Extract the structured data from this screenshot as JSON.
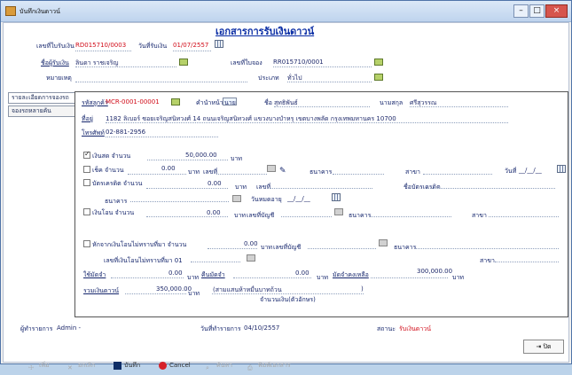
{
  "window": {
    "title": "บันทึกเงินดาวน์"
  },
  "doc": {
    "title": "เอกสารการรับเงินดาวน์"
  },
  "header": {
    "receipt_no_label": "เลขที่ใบรับเงิน",
    "receipt_no": "RD015710/0003",
    "receipt_date_label": "วันที่รับเงิน",
    "receipt_date": "01/07/2557",
    "receiver_label": "ชื่อผู้รับเงิน",
    "receiver": "ลินดา ราชเจริญ",
    "booking_label": "เลขที่ใบจอง",
    "booking_no": "RR015710/0001",
    "note_label": "หมายเหตุ",
    "type_label": "ประเภท",
    "type_value": "ทั่วไป"
  },
  "tabs": [
    {
      "label": "รายละเอียดการจองรถ"
    },
    {
      "label": "จองรถหลายคัน"
    }
  ],
  "customer": {
    "code_label": "รหัสลูกค้า",
    "code": "MCR-0001-00001",
    "title_label": "คำนำหน้า",
    "title": "นาย",
    "first_label": "ชื่อ",
    "first": "สุทธิพันธ์",
    "last_label": "นามสกุล",
    "last": "ศรีสุวรรณ",
    "address_label": "ที่อยู่",
    "address": "1182 ลิเบอร์ ซอยเจริญสนิทวงศ์ 14 ถนนเจริญสนิทวงศ์ แขวงบางบำหรุ เขตบางพลัด กรุงเทพมหานคร 10700",
    "phone_label": "โทรศัพท์",
    "phone": "02-881-2956"
  },
  "payment": {
    "cash_label": "เงินสด จำนวน",
    "cash_amount": "50,000.00",
    "cash_unit": "บาท",
    "cheque_label": "เช็ค จำนวน",
    "cheque_amount": "0.00",
    "cheque_unit": "บาท",
    "cheque_no_label": "เลขที่",
    "cheque_bank_label": "ธนาคาร",
    "cheque_branch_label": "สาขา",
    "cheque_date_label": "วันที่",
    "cheque_date": "__/__/__",
    "card_label": "บัตรเครดิต จำนวน",
    "card_amount": "0.00",
    "card_unit": "บาท",
    "card_no_label": "เลขที่",
    "card_bank_label": "ธนาคาร",
    "card_name_label": "ชื่อบัตรเครดิต",
    "card_expire_label": "วันหมดอายุ",
    "card_expire": "__/__/__",
    "transfer_label": "เงินโอน จำนวน",
    "transfer_amount": "0.00",
    "transfer_unit": "บาท",
    "account_label": "เลขที่บัญชี",
    "transfer_bank_label": "ธนาคาร",
    "transfer_branch_label": "สาขา",
    "deduct_label": "หักจากเงินโอนไม่ทราบที่มา จำนวน",
    "deduct_amount": "0.00",
    "deduct_unit": "บาท",
    "deduct_account_label": "เลขที่บัญชี",
    "deduct_bank_label": "ธนาคาร",
    "deduct_no_label": "เลขที่เงินโอนไม่ทราบที่มา 01",
    "deduct_branch_label": "สาขา",
    "discount_label": "ใช้มัดจำ",
    "discount_amount": "0.00",
    "discount_unit": "บาท",
    "deposit_label": "คืนมัดจำ",
    "deposit_amount": "0.00",
    "deposit_unit": "บาท",
    "remain_label": "มัดจำคงเหลือ",
    "remain_amount": "300,000.00",
    "remain_unit": "บาท",
    "total_label": "รวมเงินดาวน์",
    "total_amount": "350,000.00",
    "total_unit": "บาท",
    "total_words": "(สามแสนห้าหมื่นบาทถ้วน",
    "total_words_end": ")",
    "total_words_label": "จำนวนเงิน(ตัวอักษร)"
  },
  "status": {
    "creator_label": "ผู้ทำรายการ",
    "creator": "Admin -",
    "date_label": "วันที่ทำรายการ",
    "date": "04/10/2557",
    "state_label": "สถานะ",
    "state": "รับเงินดาวน์"
  },
  "toolbar": {
    "add": "เพิ่ม",
    "cancel_doc": "ยกเลิก",
    "save": "บันทึก",
    "cancel": "Cancel",
    "search": "ค้นหา",
    "print": "พิมพ์เอกสาร",
    "close": "ปิด"
  }
}
